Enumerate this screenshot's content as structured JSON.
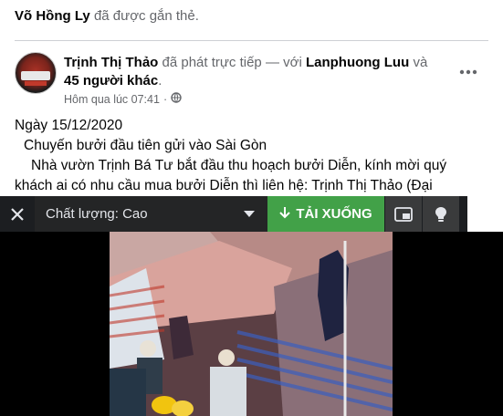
{
  "tag_line": {
    "user": "Võ Hồng Ly",
    "text": "đã được gắn thẻ."
  },
  "post": {
    "author": "Trịnh Thị Thảo",
    "action": "đã phát trực tiếp — với",
    "tagged": "Lanphuong Luu",
    "conj": "và",
    "others": "45 người khác",
    "period": ".",
    "timestamp": "Hôm qua lúc 07:41",
    "separator": "·",
    "body_lines": [
      "Ngày 15/12/2020",
      "  Chuyến bưởi đầu tiên gửi vào Sài Gòn",
      "    Nhà vườn Trịnh Bá Tư bắt đầu thu hoạch bưởi Diễn, kính mời quý",
      "khách ai có nhu cầu mua bưởi Diễn thì liên hệ: Trịnh Thị Thảo (Đại"
    ]
  },
  "video_toolbar": {
    "quality_label": "Chất lượng: Cao",
    "download_label": "TẢI XUỐNG",
    "icons": [
      "close-icon",
      "chevron-down-icon",
      "download-arrow-icon",
      "picture-in-picture-icon",
      "lightbulb-icon"
    ]
  },
  "colors": {
    "download_green": "#42a148",
    "toolbar_bg": "#1c1e21",
    "muted": "#65676b"
  }
}
